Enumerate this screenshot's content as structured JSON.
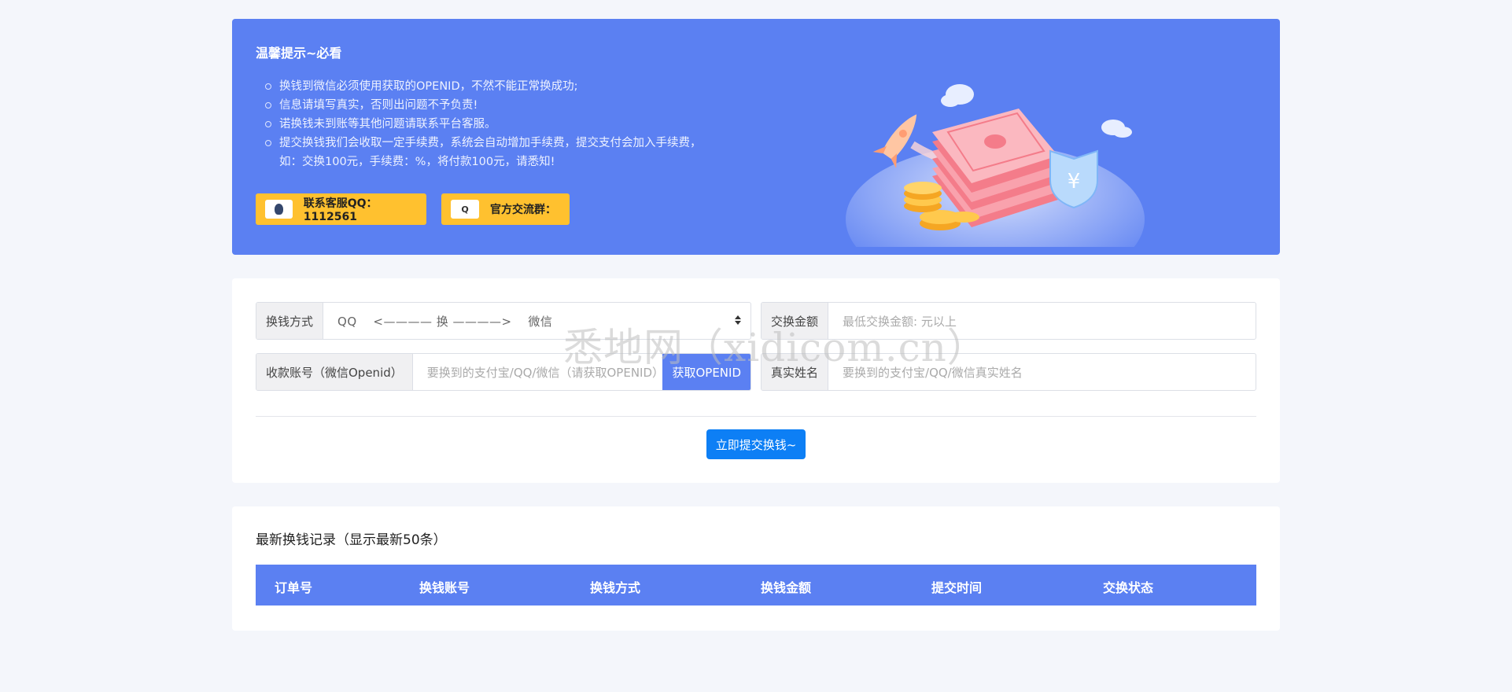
{
  "notice": {
    "title": "温馨提示~必看",
    "items": [
      "换钱到微信必须使用获取的OPENID，不然不能正常换成功;",
      "信息请填写真实，否则出问题不予负责!",
      "诺换钱未到账等其他问题请联系平台客服。",
      "提交换钱我们会收取一定手续费，系统会自动增加手续费，提交支付会加入手续费，",
      "如：交换100元，手续费：%，将付款100元，请悉知!"
    ],
    "contact_qq_label": "联系客服QQ：1112561",
    "group_label": "官方交流群：",
    "group_icon_text": "Q"
  },
  "form": {
    "method_label": "换钱方式",
    "method_value": "QQ　 <———— 换 ————>　 微信",
    "amount_label": "交换金额",
    "amount_placeholder": "最低交换金额: 元以上",
    "account_label": "收款账号（微信Openid）",
    "account_placeholder": "要换到的支付宝/QQ/微信（请获取OPENID）",
    "get_openid_label": "获取OPENID",
    "name_label": "真实姓名",
    "name_placeholder": "要换到的支付宝/QQ/微信真实姓名",
    "submit_label": "立即提交换钱~"
  },
  "records": {
    "title": "最新换钱记录（显示最新50条）",
    "columns": [
      "订单号",
      "换钱账号",
      "换钱方式",
      "换钱金额",
      "提交时间",
      "交换状态"
    ]
  },
  "watermark": "悉地网（xidicom.cn）",
  "colors": {
    "primary": "#5b80f2",
    "yellow": "#ffc12f",
    "submit": "#0d7ff5",
    "background": "#f4f6fb"
  }
}
